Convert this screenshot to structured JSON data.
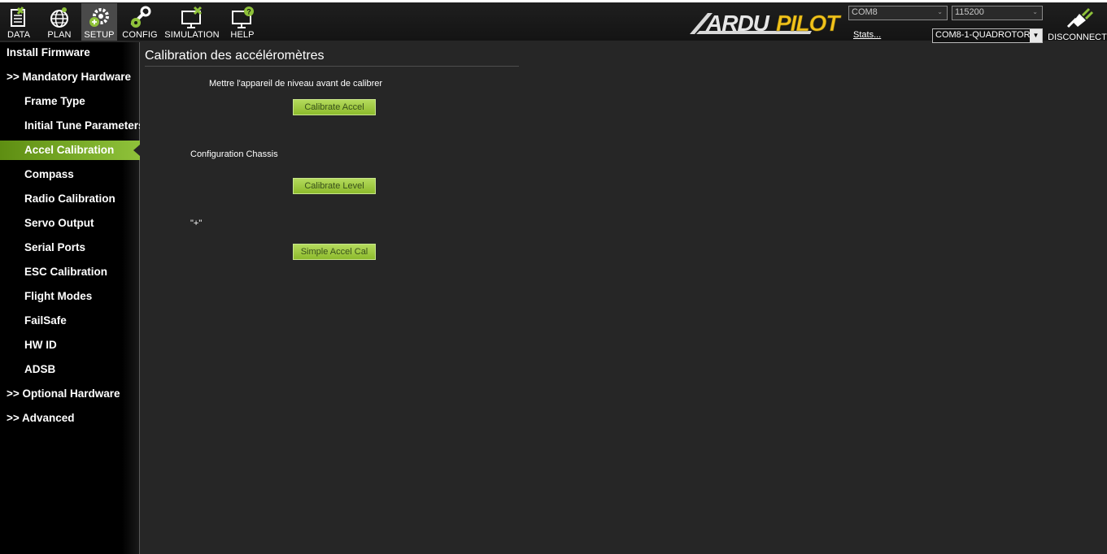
{
  "toolbar": {
    "buttons": [
      {
        "label": "DATA",
        "icon": "data-icon"
      },
      {
        "label": "PLAN",
        "icon": "globe-icon"
      },
      {
        "label": "SETUP",
        "icon": "setup-gear-icon",
        "active": true
      },
      {
        "label": "CONFIG",
        "icon": "wrench-icon"
      },
      {
        "label": "SIMULATION",
        "icon": "simulation-icon"
      },
      {
        "label": "HELP",
        "icon": "help-icon"
      }
    ],
    "logo_text": "ARDUPILOT",
    "port": "COM8",
    "baud": "115200",
    "stats_link": "Stats...",
    "vehicle": "COM8-1-QUADROTOR",
    "disconnect_label": "DISCONNECT"
  },
  "sidebar": {
    "items": [
      {
        "label": "Install Firmware",
        "level": "top"
      },
      {
        "label": ">> Mandatory Hardware",
        "level": "top"
      },
      {
        "label": "Frame Type",
        "level": "sub"
      },
      {
        "label": "Initial Tune Parameters",
        "level": "sub"
      },
      {
        "label": "Accel Calibration",
        "level": "sub",
        "active": true
      },
      {
        "label": "Compass",
        "level": "sub"
      },
      {
        "label": "Radio Calibration",
        "level": "sub"
      },
      {
        "label": "Servo Output",
        "level": "sub"
      },
      {
        "label": "Serial Ports",
        "level": "sub"
      },
      {
        "label": "ESC Calibration",
        "level": "sub"
      },
      {
        "label": "Flight Modes",
        "level": "sub"
      },
      {
        "label": "FailSafe",
        "level": "sub"
      },
      {
        "label": "HW ID",
        "level": "sub"
      },
      {
        "label": "ADSB",
        "level": "sub"
      },
      {
        "label": ">> Optional Hardware",
        "level": "top"
      },
      {
        "label": ">> Advanced",
        "level": "top"
      }
    ]
  },
  "main": {
    "title": "Calibration des accéléromètres",
    "level_instruction": "Mettre l'appareil de niveau avant de calibrer",
    "calibrate_accel_label": "Calibrate Accel",
    "frame_config_label": "Configuration Chassis",
    "calibrate_level_label": "Calibrate Level",
    "frame_symbol": "\"+\"",
    "simple_accel_label": "Simple Accel Cal"
  },
  "colors": {
    "accent_green": "#8fc23a",
    "logo_yellow": "#f2c21a",
    "background": "#262626"
  }
}
